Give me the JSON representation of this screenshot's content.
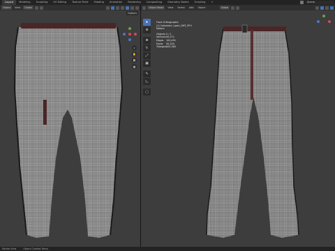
{
  "topbar": {
    "tabs": [
      "Layout",
      "Modeling",
      "Sculpting",
      "UV Editing",
      "Texture Paint",
      "Shading",
      "Animation",
      "Rendering",
      "Compositing",
      "Geometry Nodes",
      "Scripting",
      "+"
    ],
    "active_tab": "Layout",
    "scene": "Scene"
  },
  "left_viewport": {
    "header": {
      "mode": "Object",
      "editor_label": "Edit",
      "view": "View",
      "global": "Global"
    },
    "options_label": "Options"
  },
  "right_viewport": {
    "header": {
      "mode": "Object Mode",
      "view": "View",
      "select": "Select",
      "add": "Add",
      "object": "Object",
      "global": "Global"
    },
    "overlay": {
      "line1": "Front Orthographic",
      "line2": "(1) Collection | pant_SMT_PFH",
      "line3": "Meters",
      "stats": [
        {
          "label": "Objects",
          "value": "0 / 1"
        },
        {
          "label": "Vertices",
          "value": "50,271"
        },
        {
          "label": "Edges",
          "value": "100,491"
        },
        {
          "label": "Faces",
          "value": "50,204"
        },
        {
          "label": "Triangles",
          "value": "100,365"
        }
      ]
    },
    "tools": [
      "cursor",
      "select-box",
      "move",
      "rotate",
      "scale",
      "transform",
      "annotate",
      "measure",
      "add-cube"
    ]
  },
  "statusbar": {
    "left": "Rotate View",
    "middle": "Object Context Menu"
  },
  "colors": {
    "viewport_bg": "#3d3d3d",
    "active_blue": "#4772b3",
    "fabric": "#9c9c9c",
    "belt": "#4a2626"
  }
}
